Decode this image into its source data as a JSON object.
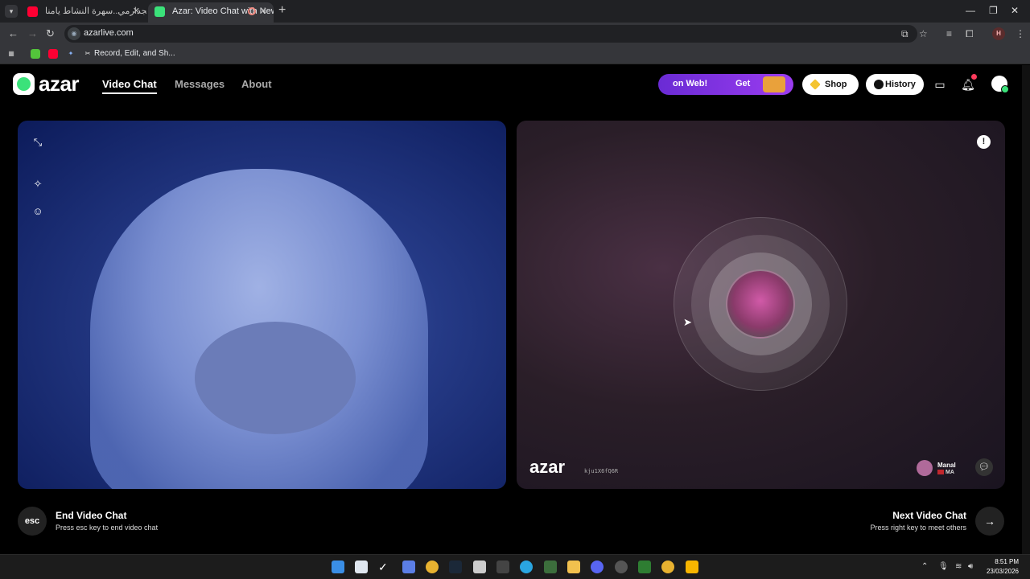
{
  "browser": {
    "tabs": [
      {
        "title": "والالجدارمي..سهرة النشاط يامنا",
        "favicon_color": "#ff0033"
      },
      {
        "title": "Azar: Video Chat with New",
        "favicon_color": "#3be27a"
      }
    ],
    "url": "azarlive.com",
    "bookmark_label": "Record, Edit, and Sh...",
    "profile_initial": "H"
  },
  "header": {
    "logo": "azar",
    "nav": [
      "Video Chat",
      "Messages",
      "About"
    ],
    "promo_text_1": "on Web!",
    "promo_text_2": "Get",
    "shop_label": "Shop",
    "history_label": "History",
    "notification_count": "1"
  },
  "peer": {
    "watermark_logo": "azar",
    "watermark_id": "kju1X6fQ6R",
    "name": "Manal",
    "country": "MA"
  },
  "controls": {
    "esc_label": "esc",
    "end_title": "End Video Chat",
    "end_sub": "Press esc key to end video chat",
    "next_title": "Next Video Chat",
    "next_sub": "Press right key to meet others"
  },
  "taskbar": {
    "time": "8:51 PM",
    "date": "23/03/2026"
  },
  "colors": {
    "accent_green": "#3be27a",
    "promo_purple": "#8a35e8"
  }
}
